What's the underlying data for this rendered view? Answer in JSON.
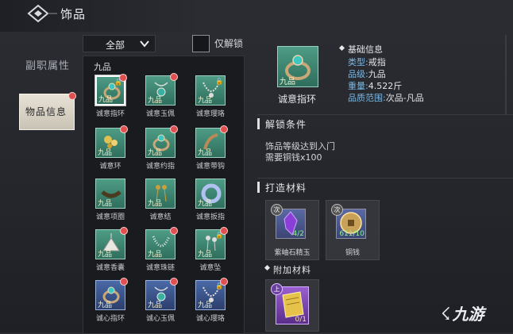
{
  "header": {
    "title": "饰品"
  },
  "side_tabs": [
    {
      "label": "副职属性"
    },
    {
      "label": "物品信息"
    }
  ],
  "filter": {
    "dropdown_value": "全部",
    "only_unlocked_label": "仅解锁"
  },
  "grid": {
    "section_title": "九品",
    "items": [
      {
        "name": "诚意指环",
        "grade": "九品",
        "color": "green",
        "locked": true,
        "badge": true,
        "selected": true,
        "icon": "ring-icon"
      },
      {
        "name": "诚意玉佩",
        "grade": "九品",
        "color": "green",
        "locked": false,
        "badge": true,
        "selected": false,
        "icon": "pendant-icon"
      },
      {
        "name": "诚意璎珞",
        "grade": "九品",
        "color": "green",
        "locked": true,
        "badge": false,
        "selected": false,
        "icon": "necklace-icon"
      },
      {
        "name": "诚意环",
        "grade": "九品",
        "color": "green",
        "locked": false,
        "badge": true,
        "selected": false,
        "icon": "hairpin-icon"
      },
      {
        "name": "诚意约指",
        "grade": "九品",
        "color": "green",
        "locked": false,
        "badge": true,
        "selected": false,
        "icon": "ring-icon"
      },
      {
        "name": "诚意带钩",
        "grade": "九品",
        "color": "green",
        "locked": false,
        "badge": true,
        "selected": false,
        "icon": "hook-icon"
      },
      {
        "name": "诚意项圈",
        "grade": "九品",
        "color": "green",
        "locked": false,
        "badge": false,
        "selected": false,
        "icon": "collar-icon"
      },
      {
        "name": "诚意结",
        "grade": "九品",
        "color": "green",
        "locked": false,
        "badge": false,
        "selected": false,
        "icon": "knot-icon"
      },
      {
        "name": "诚意扳指",
        "grade": "九品",
        "color": "green",
        "locked": false,
        "badge": false,
        "selected": false,
        "icon": "thumb-ring-icon"
      },
      {
        "name": "诚意香囊",
        "grade": "九品",
        "color": "green",
        "locked": false,
        "badge": true,
        "selected": false,
        "icon": "sachet-icon"
      },
      {
        "name": "诚意珠链",
        "grade": "九品",
        "color": "green",
        "locked": false,
        "badge": true,
        "selected": false,
        "icon": "beads-icon"
      },
      {
        "name": "诚意坠",
        "grade": "九品",
        "color": "green",
        "locked": true,
        "badge": true,
        "selected": false,
        "icon": "earring-icon"
      },
      {
        "name": "诚心指环",
        "grade": "九品",
        "color": "blue",
        "locked": false,
        "badge": true,
        "selected": false,
        "icon": "ring-icon"
      },
      {
        "name": "诚心玉佩",
        "grade": "九品",
        "color": "blue",
        "locked": false,
        "badge": true,
        "selected": false,
        "icon": "pendant-icon"
      },
      {
        "name": "诚心璎珞",
        "grade": "九品",
        "color": "blue",
        "locked": true,
        "badge": true,
        "selected": false,
        "icon": "necklace-icon"
      }
    ]
  },
  "detail": {
    "item_name": "诚意指环",
    "item_grade": "九品",
    "basic_info_title": "基础信息",
    "rows": [
      {
        "key": "类型:",
        "value": "戒指"
      },
      {
        "key": "品级:",
        "value": "九品"
      },
      {
        "key": "重量:",
        "value": "4.522斤"
      },
      {
        "key": "品质范围:",
        "value": "次品-凡品"
      }
    ],
    "unlock": {
      "title": "解锁条件",
      "lines": [
        "饰品等级达到入门",
        "需要铜钱x100"
      ]
    },
    "craft": {
      "title": "打造材料",
      "materials": [
        {
          "name": "紫岫石精玉",
          "tier": "次",
          "count": "4/2",
          "icon": "gem-icon"
        },
        {
          "name": "铜钱",
          "tier": "次",
          "count": "611/10",
          "icon": "coin-icon"
        }
      ]
    },
    "extra": {
      "title": "附加材料",
      "materials": [
        {
          "tier": "上",
          "count": "0/1",
          "icon": "scroll-icon"
        }
      ]
    }
  },
  "watermark": "九游"
}
